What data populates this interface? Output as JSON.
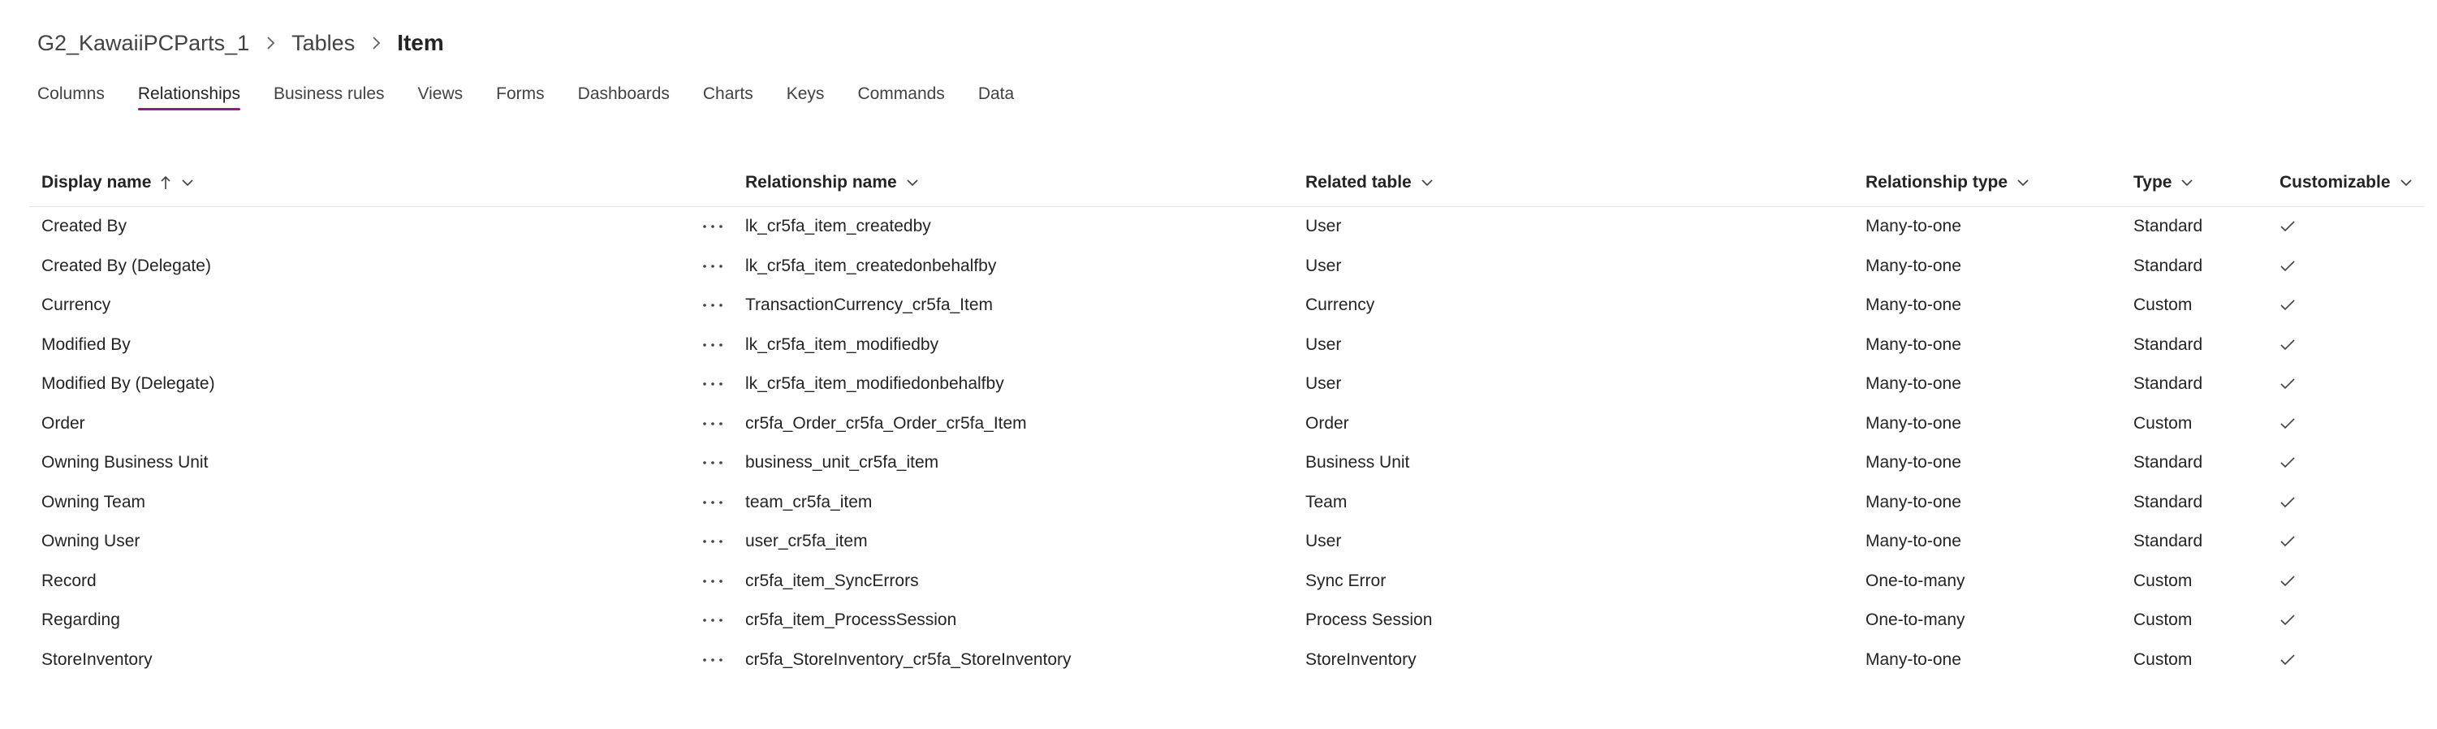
{
  "breadcrumb": {
    "app": "G2_KawaiiPCParts_1",
    "section": "Tables",
    "current": "Item"
  },
  "tabs": [
    {
      "label": "Columns"
    },
    {
      "label": "Relationships",
      "selected": true
    },
    {
      "label": "Business rules"
    },
    {
      "label": "Views"
    },
    {
      "label": "Forms"
    },
    {
      "label": "Dashboards"
    },
    {
      "label": "Charts"
    },
    {
      "label": "Keys"
    },
    {
      "label": "Commands"
    },
    {
      "label": "Data"
    }
  ],
  "table": {
    "columns": {
      "display_name": "Display name",
      "relationship_name": "Relationship name",
      "related_table": "Related table",
      "relationship_type": "Relationship type",
      "type": "Type",
      "customizable": "Customizable"
    },
    "rows": [
      {
        "display": "Created By",
        "relname": "lk_cr5fa_item_createdby",
        "related": "User",
        "reltype": "Many-to-one",
        "type": "Standard"
      },
      {
        "display": "Created By (Delegate)",
        "relname": "lk_cr5fa_item_createdonbehalfby",
        "related": "User",
        "reltype": "Many-to-one",
        "type": "Standard"
      },
      {
        "display": "Currency",
        "relname": "TransactionCurrency_cr5fa_Item",
        "related": "Currency",
        "reltype": "Many-to-one",
        "type": "Custom"
      },
      {
        "display": "Modified By",
        "relname": "lk_cr5fa_item_modifiedby",
        "related": "User",
        "reltype": "Many-to-one",
        "type": "Standard"
      },
      {
        "display": "Modified By (Delegate)",
        "relname": "lk_cr5fa_item_modifiedonbehalfby",
        "related": "User",
        "reltype": "Many-to-one",
        "type": "Standard"
      },
      {
        "display": "Order",
        "relname": "cr5fa_Order_cr5fa_Order_cr5fa_Item",
        "related": "Order",
        "reltype": "Many-to-one",
        "type": "Custom"
      },
      {
        "display": "Owning Business Unit",
        "relname": "business_unit_cr5fa_item",
        "related": "Business Unit",
        "reltype": "Many-to-one",
        "type": "Standard"
      },
      {
        "display": "Owning Team",
        "relname": "team_cr5fa_item",
        "related": "Team",
        "reltype": "Many-to-one",
        "type": "Standard"
      },
      {
        "display": "Owning User",
        "relname": "user_cr5fa_item",
        "related": "User",
        "reltype": "Many-to-one",
        "type": "Standard"
      },
      {
        "display": "Record",
        "relname": "cr5fa_item_SyncErrors",
        "related": "Sync Error",
        "reltype": "One-to-many",
        "type": "Custom"
      },
      {
        "display": "Regarding",
        "relname": "cr5fa_item_ProcessSession",
        "related": "Process Session",
        "reltype": "One-to-many",
        "type": "Custom"
      },
      {
        "display": "StoreInventory",
        "relname": "cr5fa_StoreInventory_cr5fa_StoreInventory",
        "related": "StoreInventory",
        "reltype": "Many-to-one",
        "type": "Custom"
      }
    ]
  },
  "icons": {
    "breadcrumb_separator": "chevron-right-icon",
    "column_menu": "chevron-down-icon",
    "sort": "arrow-up-icon",
    "row_more": "more-horizontal-icon",
    "customizable": "checkmark-icon"
  },
  "colors": {
    "accent": "#8a1d86",
    "text": "#242424",
    "muted": "#424242"
  }
}
